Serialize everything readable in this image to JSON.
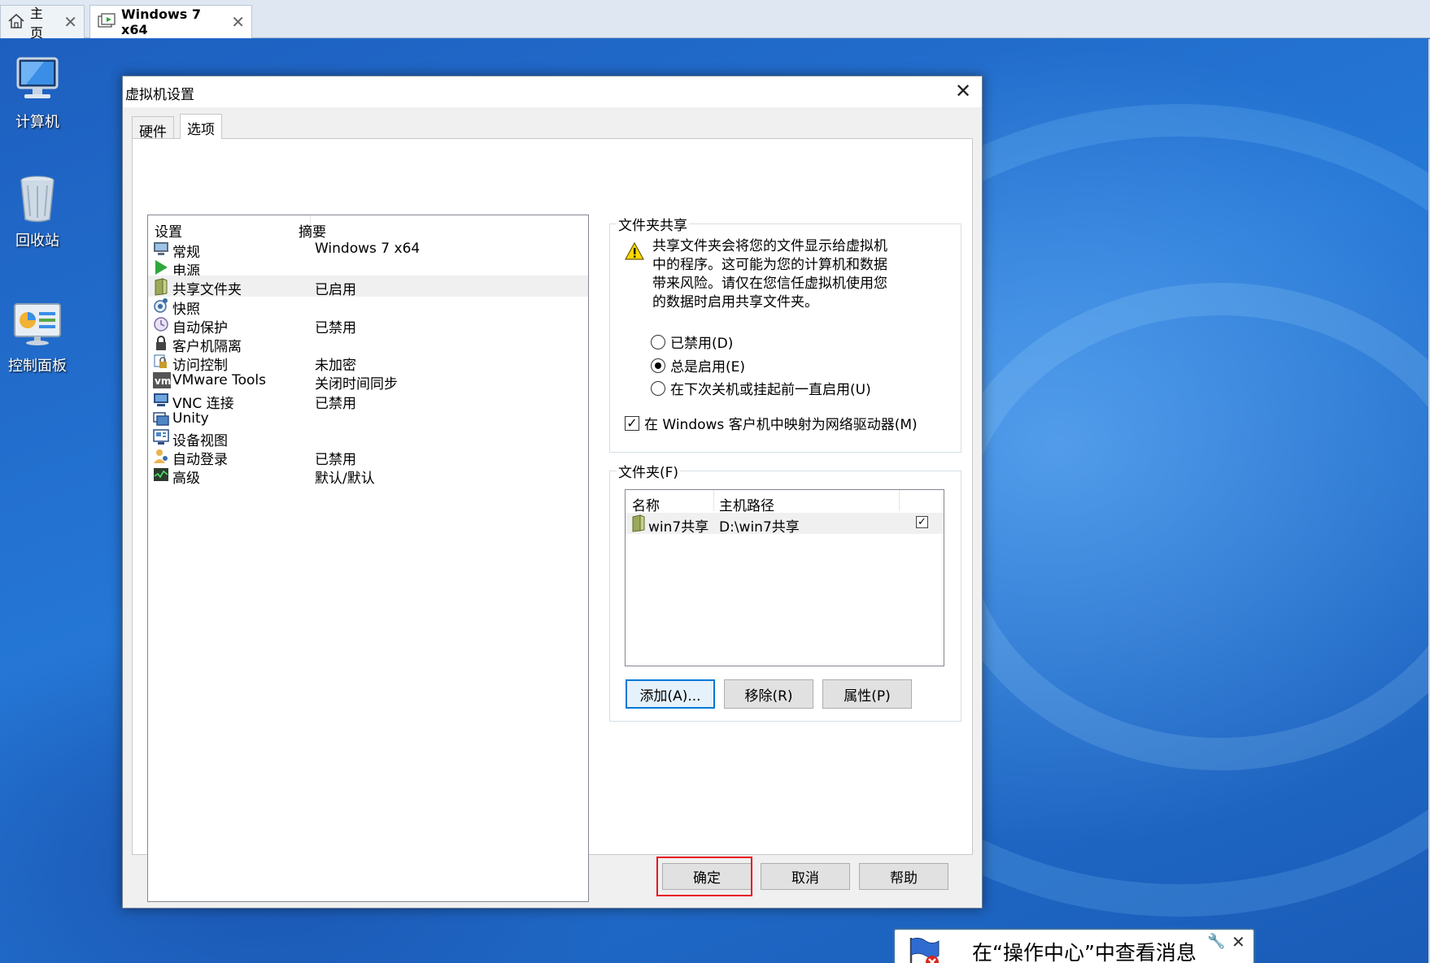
{
  "app_tabs": [
    {
      "label": "主页",
      "icon": "home-icon"
    },
    {
      "label": "Windows 7 x64",
      "icon": "vm-icon"
    }
  ],
  "desktop_icons": [
    {
      "label": "计算机",
      "icon": "computer-icon"
    },
    {
      "label": "回收站",
      "icon": "recycle-bin-icon"
    },
    {
      "label": "控制面板",
      "icon": "control-panel-icon"
    }
  ],
  "dialog": {
    "title": "虚拟机设置",
    "tabs": [
      "硬件",
      "选项"
    ],
    "active_tab": "选项",
    "list_headers": {
      "setting": "设置",
      "summary": "摘要"
    },
    "settings": [
      {
        "name": "常规",
        "summary": "Windows 7 x64",
        "icon": "monitor-icon"
      },
      {
        "name": "电源",
        "summary": "",
        "icon": "power-play-icon"
      },
      {
        "name": "共享文件夹",
        "summary": "已启用",
        "icon": "shared-folder-icon",
        "selected": true
      },
      {
        "name": "快照",
        "summary": "",
        "icon": "snapshot-icon"
      },
      {
        "name": "自动保护",
        "summary": "已禁用",
        "icon": "autoprotect-icon"
      },
      {
        "name": "客户机隔离",
        "summary": "",
        "icon": "lock-icon"
      },
      {
        "name": "访问控制",
        "summary": "未加密",
        "icon": "access-control-icon"
      },
      {
        "name": "VMware Tools",
        "summary": "关闭时间同步",
        "icon": "vmware-tools-icon"
      },
      {
        "name": "VNC 连接",
        "summary": "已禁用",
        "icon": "vnc-icon"
      },
      {
        "name": "Unity",
        "summary": "",
        "icon": "unity-icon"
      },
      {
        "name": "设备视图",
        "summary": "",
        "icon": "device-view-icon"
      },
      {
        "name": "自动登录",
        "summary": "已禁用",
        "icon": "autologin-icon"
      },
      {
        "name": "高级",
        "summary": "默认/默认",
        "icon": "advanced-icon"
      }
    ],
    "share_group": {
      "title": "文件夹共享",
      "warning": "共享文件夹会将您的文件显示给虚拟机中的程序。这可能为您的计算机和数据带来风险。请仅在您信任虚拟机使用您的数据时启用共享文件夹。",
      "warning_lines": [
        "共享文件夹会将您的文件显示给虚拟机",
        "中的程序。这可能为您的计算机和数据",
        "带来风险。请仅在您信任虚拟机使用您",
        "的数据时启用共享文件夹。"
      ],
      "radios": [
        {
          "label": "已禁用(D)",
          "checked": false
        },
        {
          "label": "总是启用(E)",
          "checked": true
        },
        {
          "label": "在下次关机或挂起前一直启用(U)",
          "checked": false
        }
      ],
      "map_drive": {
        "label": "在 Windows 客户机中映射为网络驱动器(M)",
        "checked": true
      }
    },
    "folders_group": {
      "title": "文件夹(F)",
      "columns": [
        "名称",
        "主机路径"
      ],
      "rows": [
        {
          "name": "win7共享",
          "path": "D:\\win7共享",
          "enabled": true
        }
      ],
      "buttons": {
        "add": "添加(A)...",
        "remove": "移除(R)",
        "properties": "属性(P)"
      }
    },
    "footer_buttons": {
      "ok": "确定",
      "cancel": "取消",
      "help": "帮助"
    }
  },
  "notification": {
    "text": "在“操作中心”中查看消息"
  },
  "colors": {
    "desktop": "#2577d6",
    "highlight": "#e81123",
    "focus": "#0078d7"
  }
}
